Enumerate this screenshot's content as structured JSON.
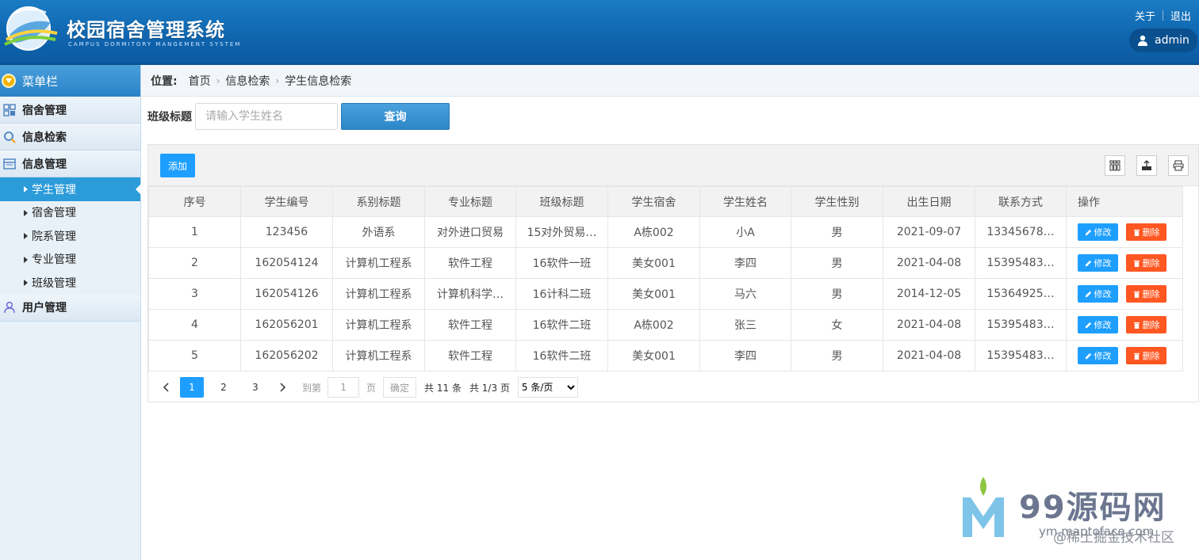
{
  "header": {
    "title": "校园宿舍管理系统",
    "subtitle": "CAMPUS DORMITORY MANGEMENT SYSTEM",
    "about_link": "关于",
    "logout_link": "退出",
    "user_name": "admin"
  },
  "sidebar": {
    "menu_title": "菜单栏",
    "groups": [
      {
        "label": "宿舍管理",
        "icon": "grid-icon"
      },
      {
        "label": "信息检索",
        "icon": "search-icon"
      },
      {
        "label": "信息管理",
        "icon": "list-icon"
      },
      {
        "label": "用户管理",
        "icon": "user-icon"
      }
    ],
    "items": [
      {
        "label": "学生管理",
        "active": true
      },
      {
        "label": "宿舍管理"
      },
      {
        "label": "院系管理"
      },
      {
        "label": "专业管理"
      },
      {
        "label": "班级管理"
      }
    ]
  },
  "breadcrumb": {
    "label": "位置:",
    "path": [
      "首页",
      "信息检索",
      "学生信息检索"
    ]
  },
  "search": {
    "label": "班级标题",
    "placeholder": "请输入学生姓名",
    "button": "查询"
  },
  "toolbar": {
    "add_label": "添加"
  },
  "table": {
    "columns": [
      "序号",
      "学生编号",
      "系别标题",
      "专业标题",
      "班级标题",
      "学生宿舍",
      "学生姓名",
      "学生性别",
      "出生日期",
      "联系方式",
      "操作"
    ],
    "rows": [
      [
        "1",
        "123456",
        "外语系",
        "对外进口贸易",
        "15对外贸易…",
        "A栋002",
        "小A",
        "男",
        "2021-09-07",
        "13345678…"
      ],
      [
        "2",
        "162054124",
        "计算机工程系",
        "软件工程",
        "16软件一班",
        "美女001",
        "李四",
        "男",
        "2021-04-08",
        "15395483…"
      ],
      [
        "3",
        "162054126",
        "计算机工程系",
        "计算机科学…",
        "16计科二班",
        "美女001",
        "马六",
        "男",
        "2014-12-05",
        "15364925…"
      ],
      [
        "4",
        "162056201",
        "计算机工程系",
        "软件工程",
        "16软件二班",
        "A栋002",
        "张三",
        "女",
        "2021-04-08",
        "15395483…"
      ],
      [
        "5",
        "162056202",
        "计算机工程系",
        "软件工程",
        "16软件二班",
        "美女001",
        "李四",
        "男",
        "2021-04-08",
        "15395483…"
      ]
    ],
    "edit_label": "修改",
    "delete_label": "删除"
  },
  "pager": {
    "pages": [
      "1",
      "2",
      "3"
    ],
    "current": "1",
    "goto_label": "到第",
    "goto_value": "1",
    "page_unit": "页",
    "confirm": "确定",
    "total": "共 11 条",
    "page_info": "共 1/3 页",
    "page_size": "5 条/页"
  },
  "watermark": {
    "brand": "99源码网",
    "url": "ym.maptoface.com",
    "credit": "@稀土掘金技术社区"
  },
  "colors": {
    "header_blue": "#0f64ad",
    "accent_blue": "#1e9fff",
    "danger": "#ff5722",
    "sidebar_active": "#2c9bda"
  }
}
